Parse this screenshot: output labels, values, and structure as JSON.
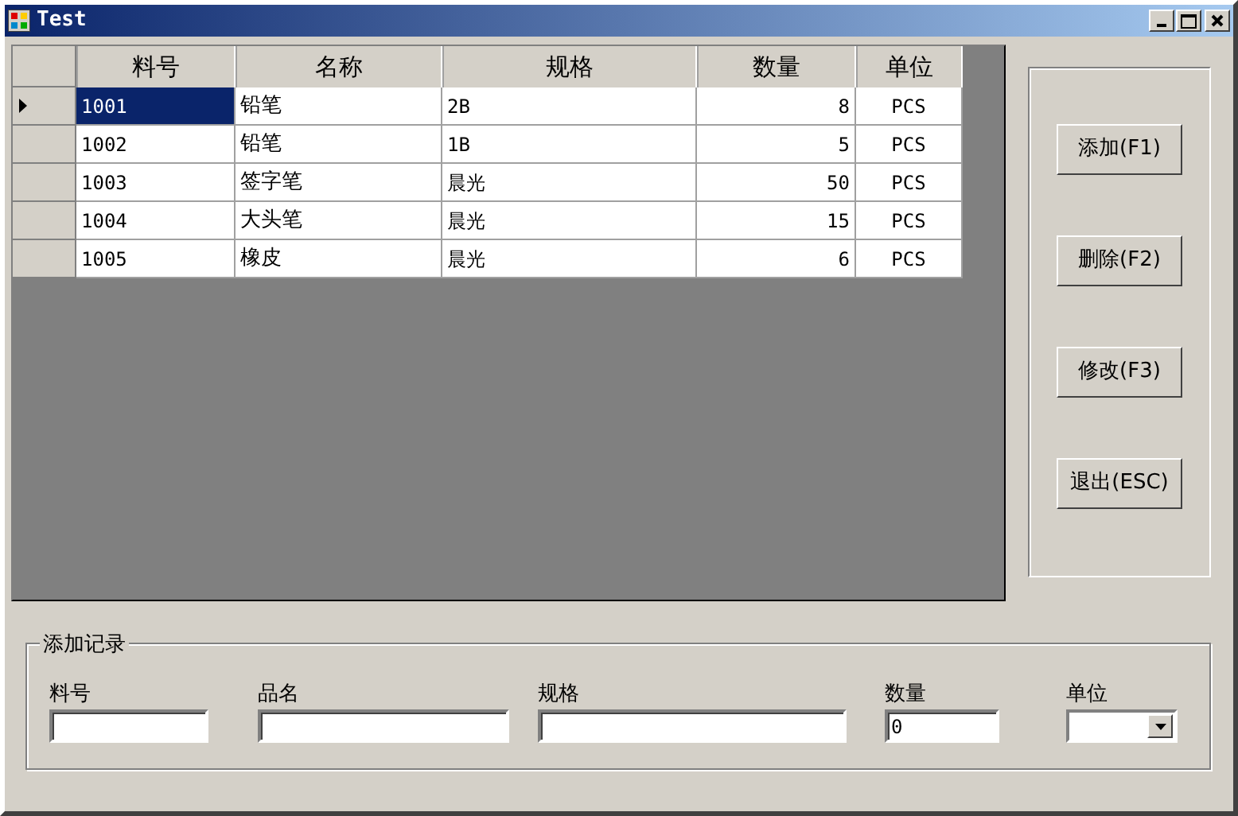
{
  "window": {
    "title": "Test"
  },
  "grid": {
    "columns": [
      "料号",
      "名称",
      "规格",
      "数量",
      "单位"
    ],
    "rows": [
      {
        "cells": [
          "1001",
          "铅笔",
          "2B",
          "8",
          "PCS"
        ],
        "selected": true
      },
      {
        "cells": [
          "1002",
          "铅笔",
          "1B",
          "5",
          "PCS"
        ],
        "selected": false
      },
      {
        "cells": [
          "1003",
          "签字笔",
          "晨光",
          "50",
          "PCS"
        ],
        "selected": false
      },
      {
        "cells": [
          "1004",
          "大头笔",
          "晨光",
          "15",
          "PCS"
        ],
        "selected": false
      },
      {
        "cells": [
          "1005",
          "橡皮",
          "晨光",
          "6",
          "PCS"
        ],
        "selected": false
      }
    ]
  },
  "buttons": [
    "添加(F1)",
    "删除(F2)",
    "修改(F3)",
    "退出(ESC)"
  ],
  "add_record": {
    "title": "添加记录",
    "fields": [
      {
        "label": "料号",
        "kind": "text"
      },
      {
        "label": "品名",
        "kind": "text"
      },
      {
        "label": "规格",
        "kind": "text"
      },
      {
        "label": "数量",
        "kind": "text",
        "value": "0"
      },
      {
        "label": "单位",
        "kind": "combo"
      }
    ]
  }
}
